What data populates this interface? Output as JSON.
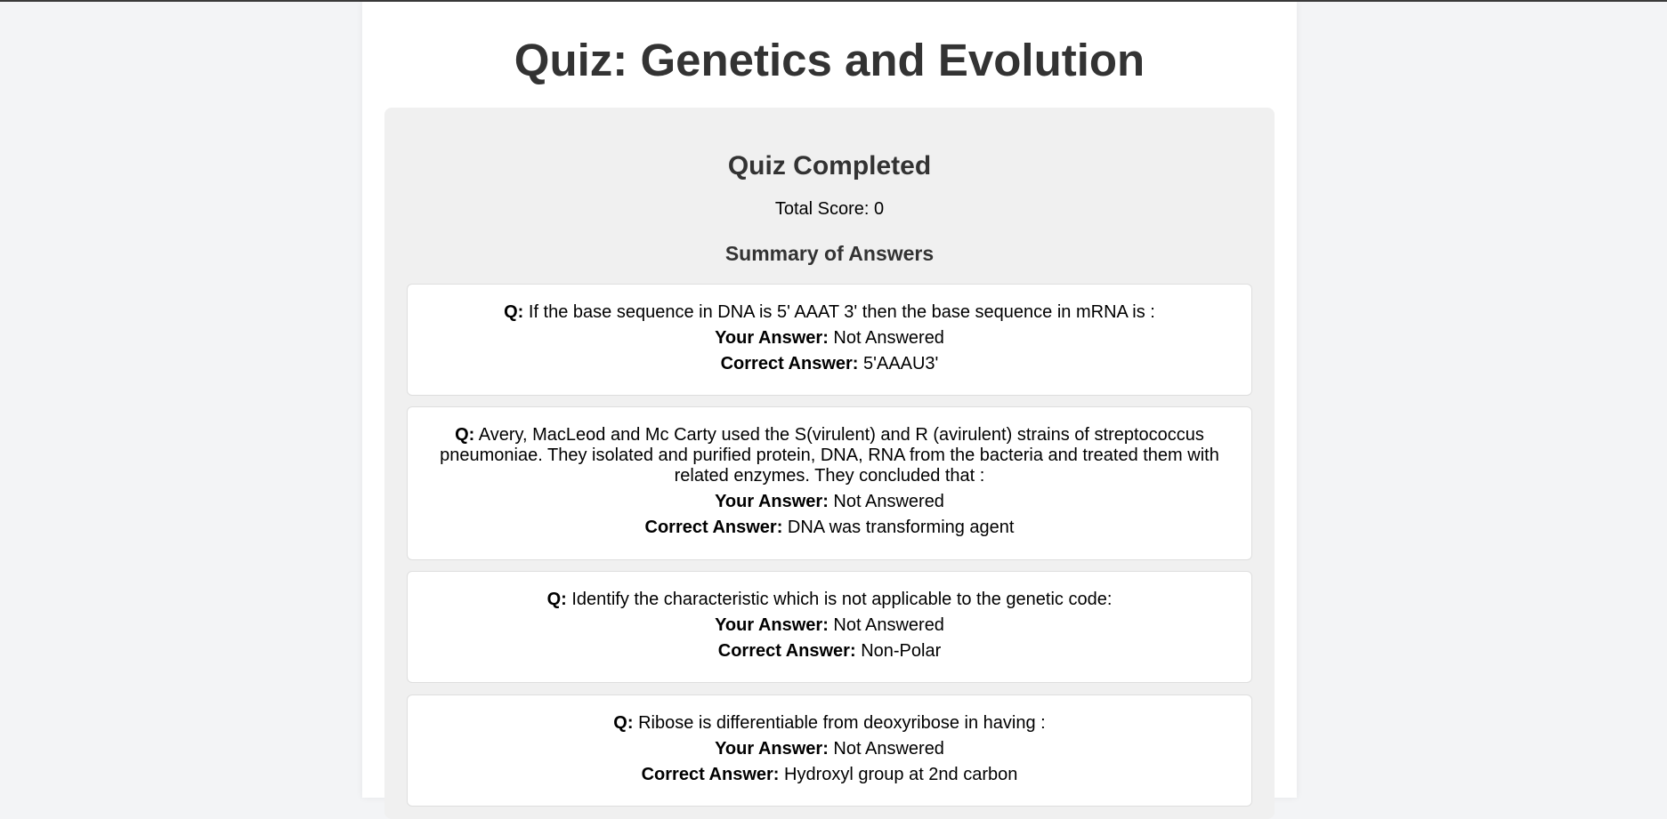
{
  "page": {
    "title": "Quiz: Genetics and Evolution"
  },
  "result": {
    "heading": "Quiz Completed",
    "score_label": "Total Score:",
    "score_value": "0",
    "summary_heading": "Summary of Answers",
    "question_prefix": "Q:",
    "your_answer_label": "Your Answer:",
    "correct_answer_label": "Correct Answer:"
  },
  "answers": [
    {
      "question": "If the base sequence in DNA is 5' AAAT 3' then the base sequence in mRNA is :",
      "your_answer": "Not Answered",
      "correct_answer": "5'AAAU3'"
    },
    {
      "question": "Avery, MacLeod and Mc Carty used the S(virulent) and R (avirulent) strains of streptococcus pneumoniae. They isolated and purified protein, DNA, RNA from the bacteria and treated them with related enzymes. They concluded that :",
      "your_answer": "Not Answered",
      "correct_answer": "DNA was transforming agent"
    },
    {
      "question": "Identify the characteristic which is not applicable to the genetic code:",
      "your_answer": "Not Answered",
      "correct_answer": "Non-Polar"
    },
    {
      "question": "Ribose is differentiable from deoxyribose in having :",
      "your_answer": "Not Answered",
      "correct_answer": "Hydroxyl group at 2nd carbon"
    }
  ]
}
